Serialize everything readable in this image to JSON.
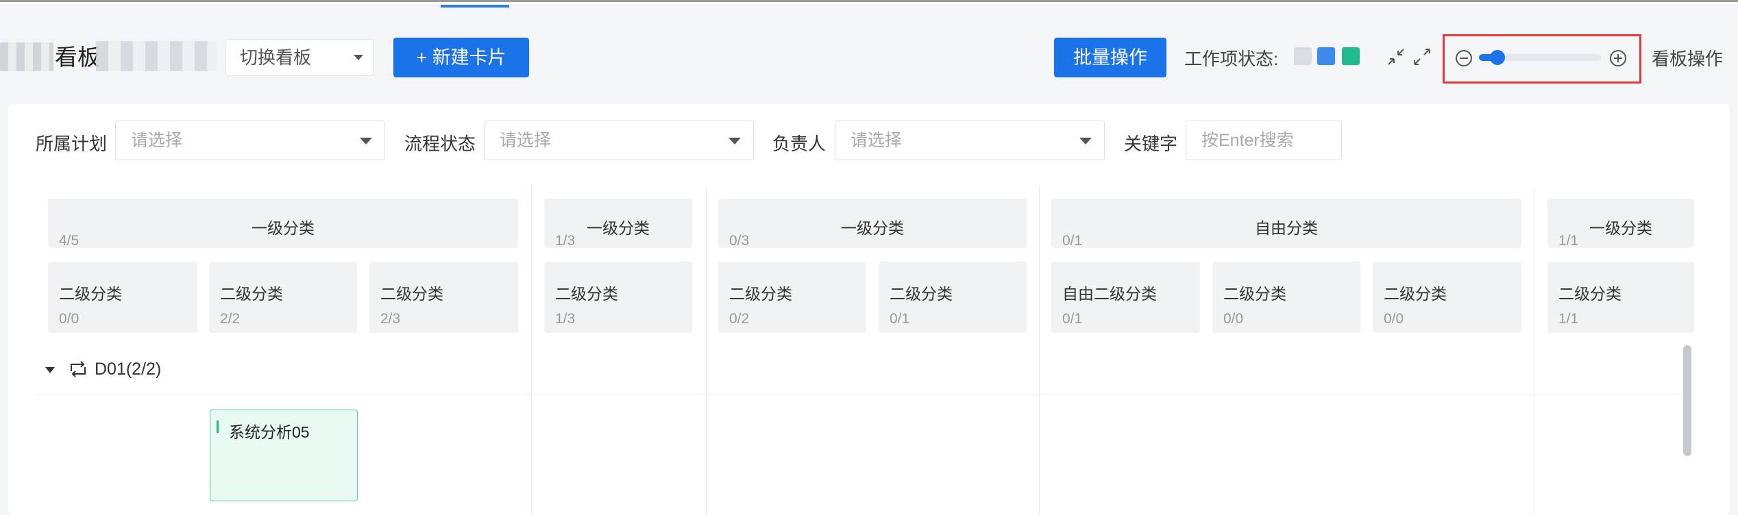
{
  "header": {
    "board_title": "看板",
    "switch_board": "切换看板",
    "new_card": "+ 新建卡片",
    "batch_ops": "批量操作",
    "work_status_label": "工作项状态:",
    "status_colors": [
      "#d9dce1",
      "#3c8cf0",
      "#22b98f"
    ],
    "board_ops": "看板操作",
    "zoom_level": 0.15
  },
  "filters": {
    "plan_label": "所属计划",
    "plan_placeholder": "请选择",
    "flow_label": "流程状态",
    "flow_placeholder": "请选择",
    "owner_label": "负责人",
    "owner_placeholder": "请选择",
    "keyword_label": "关键字",
    "keyword_placeholder": "按Enter搜索"
  },
  "categories": [
    {
      "title": "一级分类",
      "count": "4/5",
      "subs": [
        {
          "title": "二级分类",
          "count": "0/0"
        },
        {
          "title": "二级分类",
          "count": "2/2"
        },
        {
          "title": "二级分类",
          "count": "2/3"
        }
      ]
    },
    {
      "title": "一级分类",
      "count": "1/3",
      "subs": [
        {
          "title": "二级分类",
          "count": "1/3"
        }
      ]
    },
    {
      "title": "一级分类",
      "count": "0/3",
      "subs": [
        {
          "title": "二级分类",
          "count": "0/2"
        },
        {
          "title": "二级分类",
          "count": "0/1"
        }
      ]
    },
    {
      "title": "自由分类",
      "count": "0/1",
      "subs": [
        {
          "title": "自由二级分类",
          "count": "0/1"
        },
        {
          "title": "二级分类",
          "count": "0/0"
        },
        {
          "title": "二级分类",
          "count": "0/0"
        }
      ]
    },
    {
      "title": "一级分类",
      "count": "1/1",
      "subs": [
        {
          "title": "二级分类",
          "count": "1/1"
        }
      ]
    }
  ],
  "swimlane": {
    "label": "D01(2/2)"
  },
  "cards": [
    {
      "title": "系统分析05"
    }
  ],
  "icons": {
    "collapse": "collapse-arrows-icon",
    "expand": "expand-arrows-icon",
    "zoom_out": "zoom-out-icon",
    "zoom_in": "zoom-in-icon",
    "lane": "loop-icon"
  }
}
